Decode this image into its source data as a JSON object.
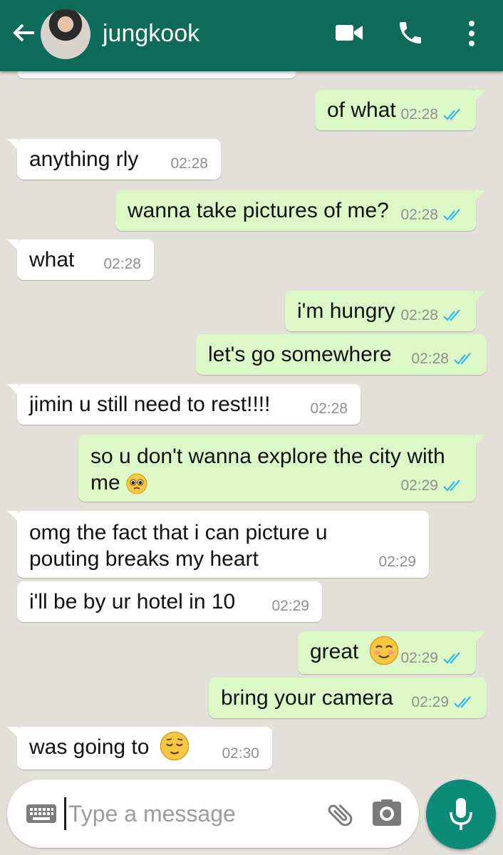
{
  "header": {
    "contact_name": "jungkook",
    "icons": [
      "back-arrow-icon",
      "video-call-icon",
      "voice-call-icon",
      "more-options-icon"
    ]
  },
  "messages": [
    {
      "dir": "out",
      "text": "of what",
      "time": "02:28",
      "status": "read"
    },
    {
      "dir": "in",
      "text": "anything rly",
      "time": "02:28"
    },
    {
      "dir": "out",
      "text": "wanna take pictures of me?",
      "time": "02:28",
      "status": "read"
    },
    {
      "dir": "in",
      "text": "what",
      "time": "02:28"
    },
    {
      "dir": "out",
      "text": "i'm hungry",
      "time": "02:28",
      "status": "read"
    },
    {
      "dir": "out",
      "text": "let's go somewhere",
      "time": "02:28",
      "status": "read"
    },
    {
      "dir": "in",
      "text": "jimin u still need to rest!!!!",
      "time": "02:28"
    },
    {
      "dir": "out",
      "text": "so u don't wanna explore the city with me",
      "emoji": "pleading-face",
      "time": "02:29",
      "status": "read"
    },
    {
      "dir": "in",
      "text": "omg the fact that i can picture u pouting breaks my heart",
      "time": "02:29"
    },
    {
      "dir": "in",
      "text": "i'll be by ur hotel in 10",
      "time": "02:29"
    },
    {
      "dir": "out",
      "text": "great",
      "emoji": "smiling-blush-face",
      "time": "02:29",
      "status": "read"
    },
    {
      "dir": "out",
      "text": "bring your camera",
      "time": "02:29",
      "status": "read"
    },
    {
      "dir": "in",
      "text": "was going to",
      "emoji": "relieved-face",
      "time": "02:30"
    }
  ],
  "input": {
    "placeholder": "Type a message",
    "icons": [
      "keyboard-icon",
      "attach-icon",
      "camera-icon",
      "microphone-icon"
    ]
  },
  "colors": {
    "header": "#0e6b5a",
    "outgoing_bubble": "#dcf8c6",
    "incoming_bubble": "#ffffff",
    "read_ticks": "#34b7f1",
    "mic_button": "#0e8a78",
    "background": "#e3e0da"
  }
}
